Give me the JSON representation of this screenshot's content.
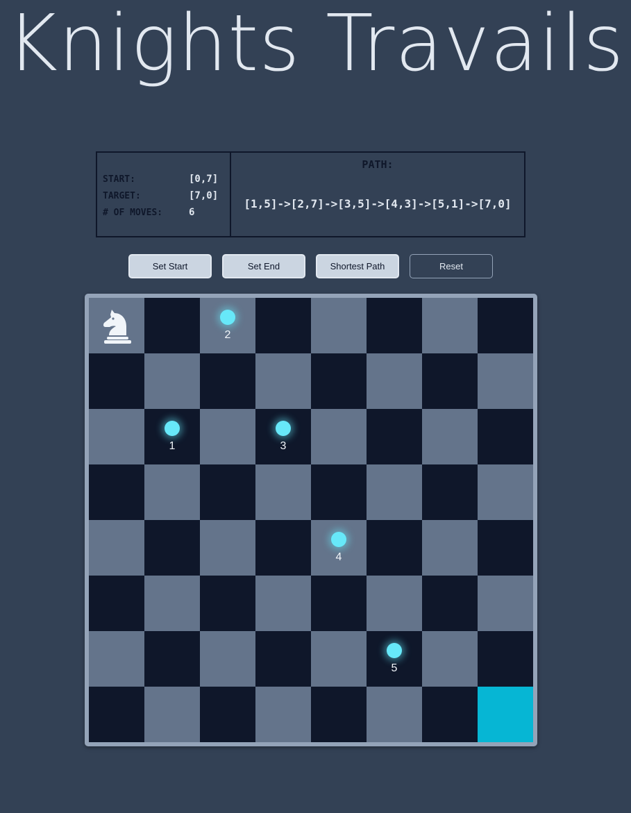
{
  "title": "Knights Travails",
  "info": {
    "start_label": "START:",
    "start_value": "[0,7]",
    "target_label": "TARGET:",
    "target_value": "[7,0]",
    "moves_label": "# OF MOVES:",
    "moves_value": "6",
    "path_label": "PATH:",
    "path_value": "[1,5]->[2,7]->[3,5]->[4,3]->[5,1]->[7,0]"
  },
  "buttons": {
    "set_start": "Set Start",
    "set_end": "Set End",
    "shortest_path": "Shortest Path",
    "reset": "Reset"
  },
  "board": {
    "size": 8,
    "knight": {
      "row": 0,
      "col": 0
    },
    "target": {
      "row": 7,
      "col": 7
    },
    "path_markers": [
      {
        "row": 2,
        "col": 1,
        "label": "1"
      },
      {
        "row": 0,
        "col": 2,
        "label": "2"
      },
      {
        "row": 2,
        "col": 3,
        "label": "3"
      },
      {
        "row": 4,
        "col": 4,
        "label": "4"
      },
      {
        "row": 6,
        "col": 5,
        "label": "5"
      }
    ]
  },
  "colors": {
    "background": "#334155",
    "light_square": "#64748b",
    "dark_square": "#0f172a",
    "target_square": "#06b6d4",
    "path_dot": "#67e8f9"
  },
  "icons": {
    "knight": "chess-knight-icon"
  }
}
